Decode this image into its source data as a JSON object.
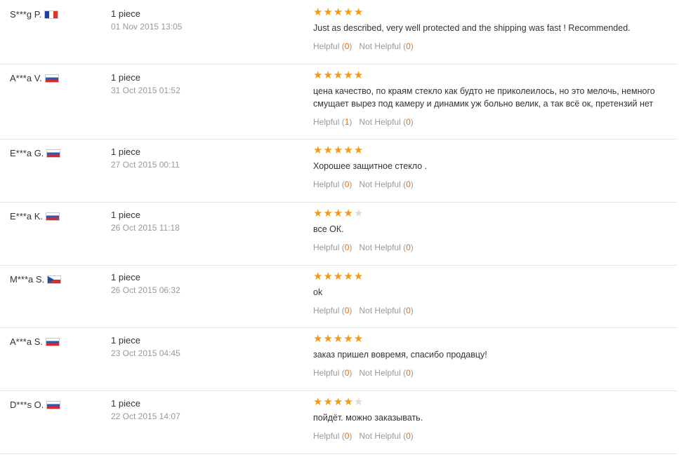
{
  "colors": {
    "star_on": "#f39a12",
    "star_off": "#dcdcdc",
    "count": "#e36c0a",
    "muted": "#999999"
  },
  "reviews": [
    {
      "buyer": "S***g P.",
      "country_flag": "FR",
      "quantity": "1 piece",
      "date": "01 Nov 2015 13:05",
      "rating": 5,
      "max_rating": 5,
      "text": "Just as described, very well protected and the shipping was fast ! Recommended.",
      "helpful_label": "Helpful",
      "helpful_count": "0",
      "not_helpful_label": "Not Helpful",
      "not_helpful_count": "0"
    },
    {
      "buyer": "A***a V.",
      "country_flag": "RU",
      "quantity": "1 piece",
      "date": "31 Oct 2015 01:52",
      "rating": 5,
      "max_rating": 5,
      "text": "цена качество, по краям стекло как будто не приколеилось, но это мелочь, немного смущает вырез под камеру и динамик уж больно велик, а так всё ок, претензий нет",
      "helpful_label": "Helpful",
      "helpful_count": "1",
      "not_helpful_label": "Not Helpful",
      "not_helpful_count": "0"
    },
    {
      "buyer": "E***a G.",
      "country_flag": "RU",
      "quantity": "1 piece",
      "date": "27 Oct 2015 00:11",
      "rating": 5,
      "max_rating": 5,
      "text": "Хорошее защитное стекло .",
      "helpful_label": "Helpful",
      "helpful_count": "0",
      "not_helpful_label": "Not Helpful",
      "not_helpful_count": "0"
    },
    {
      "buyer": "E***a K.",
      "country_flag": "RU",
      "quantity": "1 piece",
      "date": "26 Oct 2015 11:18",
      "rating": 4,
      "max_rating": 5,
      "text": "все ОК.",
      "helpful_label": "Helpful",
      "helpful_count": "0",
      "not_helpful_label": "Not Helpful",
      "not_helpful_count": "0"
    },
    {
      "buyer": "M***a S.",
      "country_flag": "CZ",
      "quantity": "1 piece",
      "date": "26 Oct 2015 06:32",
      "rating": 5,
      "max_rating": 5,
      "text": "ok",
      "helpful_label": "Helpful",
      "helpful_count": "0",
      "not_helpful_label": "Not Helpful",
      "not_helpful_count": "0"
    },
    {
      "buyer": "A***a S.",
      "country_flag": "RU",
      "quantity": "1 piece",
      "date": "23 Oct 2015 04:45",
      "rating": 5,
      "max_rating": 5,
      "text": "заказ пришел вовремя, спасибо продавцу!",
      "helpful_label": "Helpful",
      "helpful_count": "0",
      "not_helpful_label": "Not Helpful",
      "not_helpful_count": "0"
    },
    {
      "buyer": "D***s O.",
      "country_flag": "RU",
      "quantity": "1 piece",
      "date": "22 Oct 2015 14:07",
      "rating": 4,
      "max_rating": 5,
      "text": "пойдёт. можно заказывать.",
      "helpful_label": "Helpful",
      "helpful_count": "0",
      "not_helpful_label": "Not Helpful",
      "not_helpful_count": "0"
    }
  ]
}
